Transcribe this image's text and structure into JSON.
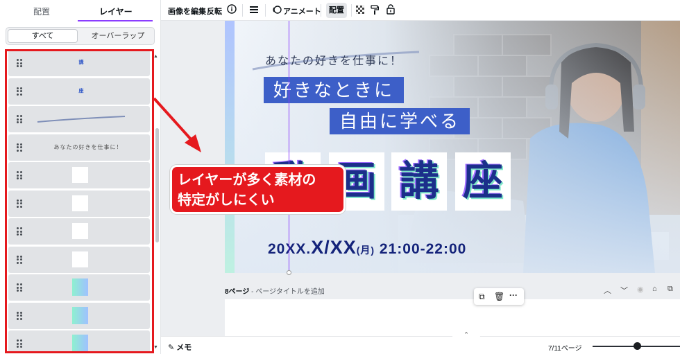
{
  "left_panel": {
    "tabs": [
      "配置",
      "レイヤー"
    ],
    "active_tab": "レイヤー",
    "filter": {
      "all_label": "すべて",
      "overlap_label": "オーバーラップ"
    },
    "layers": [
      {
        "kind": "text-small",
        "text": "講"
      },
      {
        "kind": "text-small",
        "text": "座"
      },
      {
        "kind": "stroke",
        "text": ""
      },
      {
        "kind": "text",
        "text": "あなたの好きを仕事に！"
      },
      {
        "kind": "white",
        "text": ""
      },
      {
        "kind": "white",
        "text": ""
      },
      {
        "kind": "white",
        "text": ""
      },
      {
        "kind": "white",
        "text": ""
      },
      {
        "kind": "gradient",
        "text": ""
      },
      {
        "kind": "gradient",
        "text": ""
      },
      {
        "kind": "gradient",
        "text": ""
      }
    ]
  },
  "toolbar": {
    "edit_image": "画像を編集",
    "flip": "反転",
    "info_icon": "info-icon",
    "menu_icon": "lines-icon",
    "animate": "アニメート",
    "layout": "配置",
    "transparency_icon": "checker-icon",
    "paint_icon": "paint-roller-icon",
    "lock_icon": "lock-icon"
  },
  "design": {
    "catch_copy": "あなたの好きを仕事に！",
    "line1": "好きなときに",
    "line2": "自由に学べる",
    "title_chars": [
      "動",
      "画",
      "講",
      "座"
    ],
    "date_prefix": "20XX.",
    "date_main": "X/XX",
    "date_weekday": "(月)",
    "time": "21:00-22:00"
  },
  "page_meta": {
    "page_label": "8ページ",
    "add_title": " - ページタイトルを追加"
  },
  "annotation": {
    "line1": "レイヤーが多く素材の",
    "line2": "特定がしにくい"
  },
  "bottom_bar": {
    "memo": "メモ",
    "page_count": "7/11ページ"
  },
  "colors": {
    "accent": "#8b3dff",
    "annotation_red": "#e5191e",
    "title_blue": "#3d5fc8"
  }
}
